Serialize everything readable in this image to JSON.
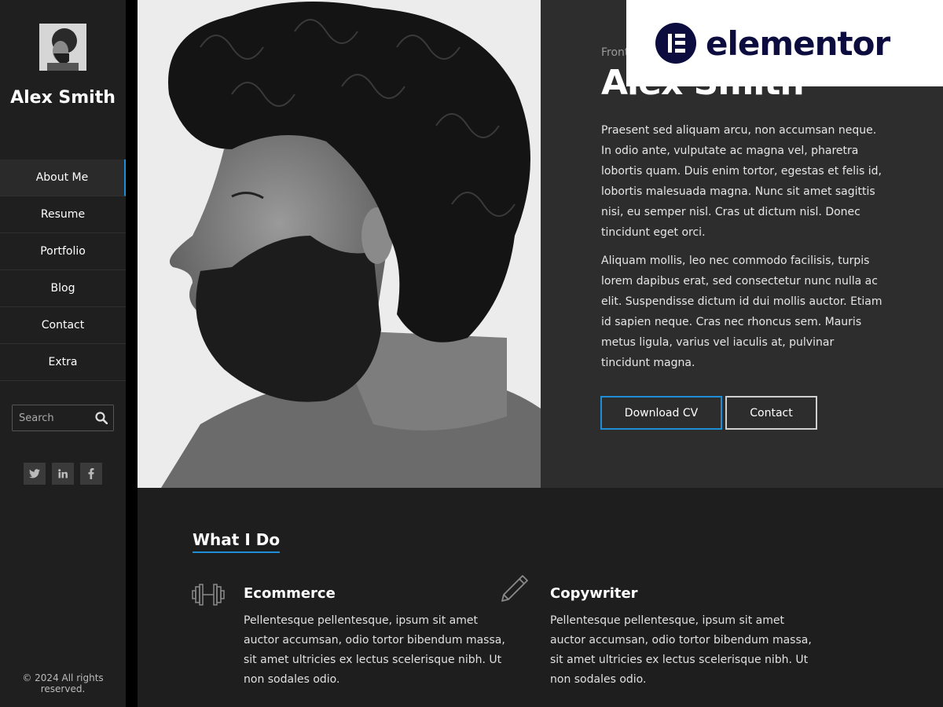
{
  "sidebar": {
    "name": "Alex Smith",
    "nav": [
      {
        "label": "About Me",
        "active": true
      },
      {
        "label": "Resume"
      },
      {
        "label": "Portfolio"
      },
      {
        "label": "Blog"
      },
      {
        "label": "Contact"
      },
      {
        "label": "Extra"
      }
    ],
    "search_placeholder": "Search",
    "social": [
      {
        "icon": "twitter-icon",
        "glyph": "t"
      },
      {
        "icon": "linkedin-icon",
        "glyph": "in"
      },
      {
        "icon": "facebook-icon",
        "glyph": "f"
      }
    ],
    "copyright": "© 2024 All rights reserved."
  },
  "hero": {
    "subtitle": "Front",
    "title": "Alex Smith",
    "paragraph1": "Praesent sed aliquam arcu, non accumsan neque. In odio ante, vulputate ac magna vel, pharetra lobortis quam. Duis enim tortor, egestas et felis id, lobortis malesuada magna. Nunc sit amet sagittis nisi, eu semper nisl. Cras ut dictum nisl. Donec tincidunt eget orci.",
    "paragraph2": "Aliquam mollis, leo nec commodo facilisis, turpis lorem dapibus erat, sed consectetur nunc nulla ac elit. Suspendisse dictum id dui mollis auctor. Etiam id sapien neque. Cras nec rhoncus sem. Mauris metus ligula, varius vel iaculis at, pulvinar tincidunt magna.",
    "download_cv": "Download CV",
    "contact": "Contact"
  },
  "badge": {
    "brand": "elementor",
    "brand_color": "#0c0d3e"
  },
  "services": {
    "title": "What I Do",
    "items": [
      {
        "icon": "dumbbell-icon",
        "title": "Ecommerce",
        "text": "Pellentesque pellentesque, ipsum sit amet auctor accumsan, odio tortor bibendum massa, sit amet ultricies ex lectus scelerisque nibh. Ut non sodales odio."
      },
      {
        "icon": "pencil-icon",
        "title": "Copywriter",
        "text": "Pellentesque pellentesque, ipsum sit amet auctor accumsan, odio tortor bibendum massa, sit amet ultricies ex lectus scelerisque nibh. Ut non sodales odio."
      }
    ]
  },
  "colors": {
    "accent": "#1e8fd6",
    "sidebar_bg": "#1f1f1f",
    "hero_bg": "#2d2d2d",
    "services_bg": "#1e1e1e"
  }
}
